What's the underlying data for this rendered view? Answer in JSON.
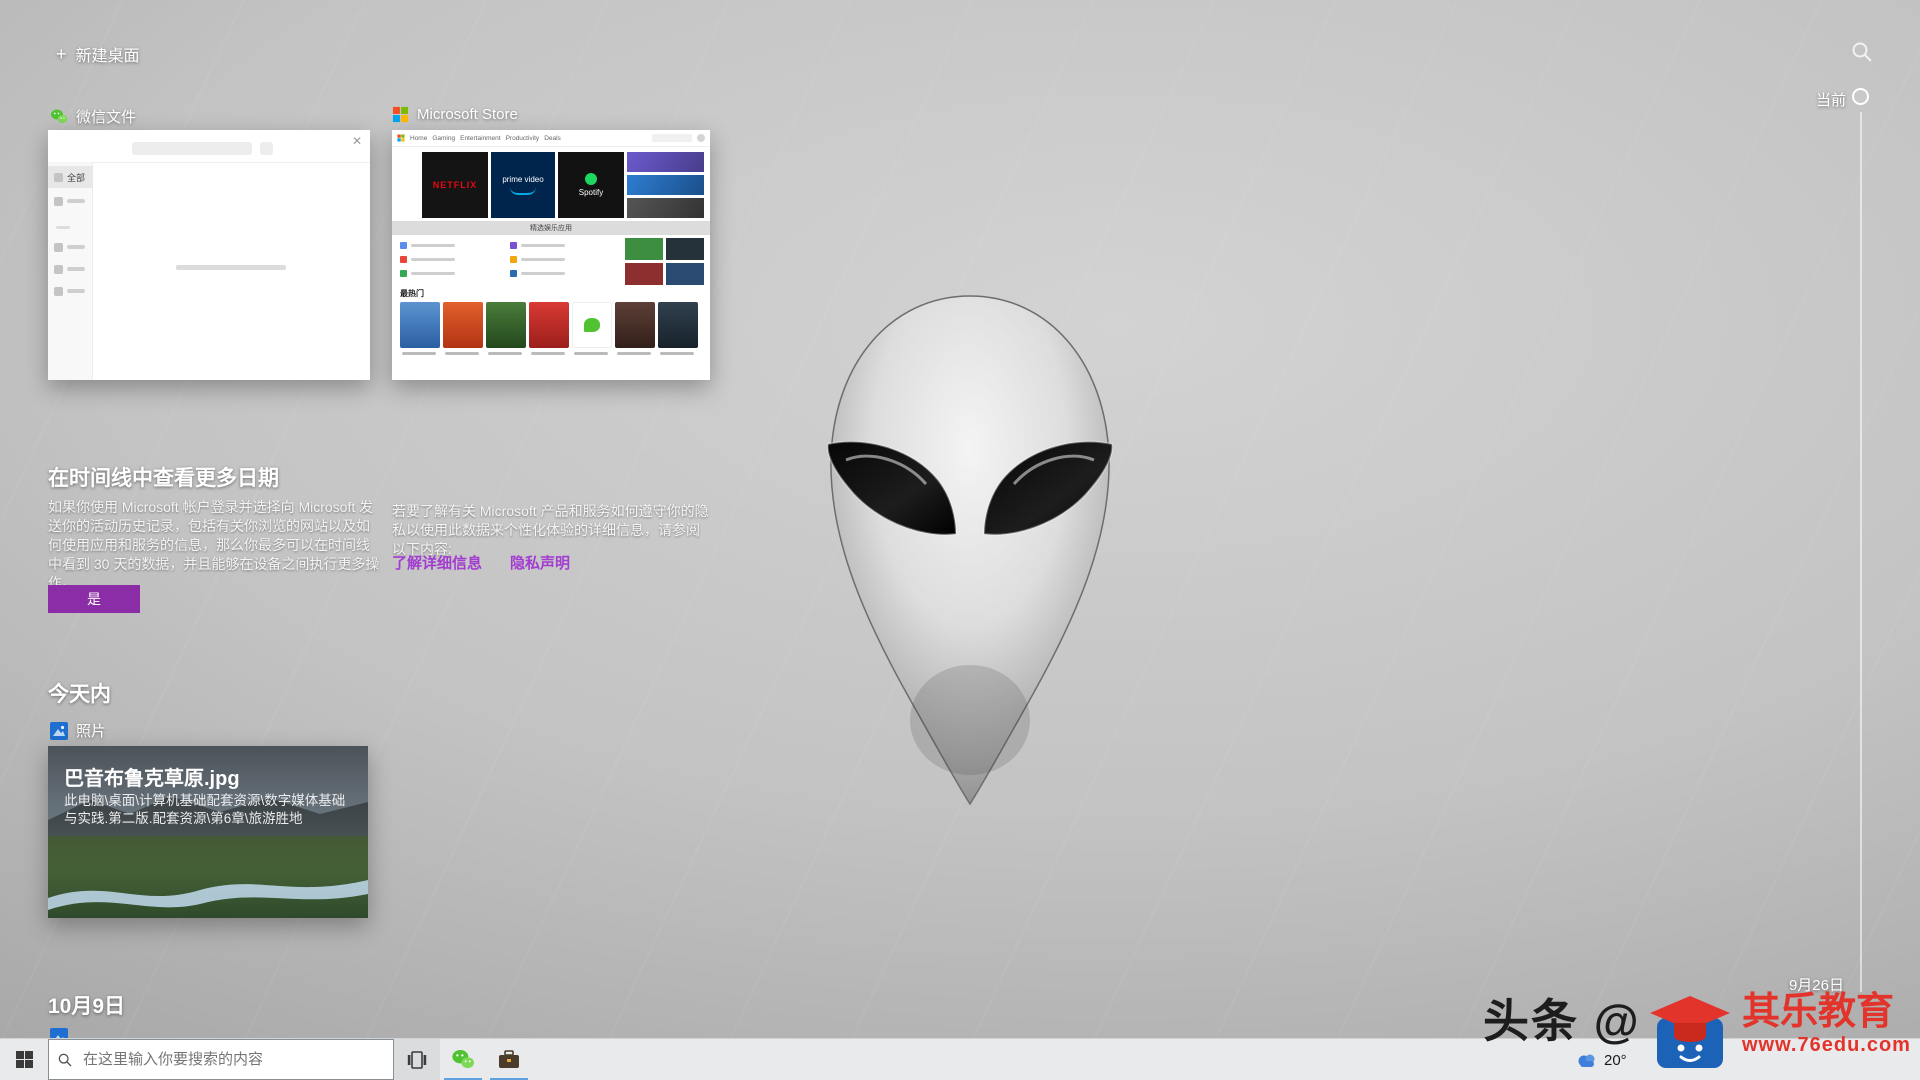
{
  "task_view": {
    "new_desktop": "新建桌面",
    "current": "当前",
    "bottom_date": "9月26日",
    "today_heading": "今天内",
    "oct9_heading": "10月9日"
  },
  "promo": {
    "title": "在时间线中查看更多日期",
    "body_left": "如果你使用 Microsoft 帐户登录并选择向 Microsoft 发送你的活动历史记录，包括有关你浏览的网站以及如何使用应用和服务的信息，那么你最多可以在时间线中看到 30 天的数据，并且能够在设备之间执行更多操作。",
    "body_right": "若要了解有关 Microsoft 产品和服务如何遵守你的隐私以使用此数据来个性化体验的详细信息，请参阅以下内容:",
    "learn_more": "了解详细信息",
    "privacy": "隐私声明",
    "yes": "是"
  },
  "apps": {
    "wechat": {
      "label": "微信文件",
      "sidebar_first": "全部"
    },
    "store": {
      "label": "Microsoft Store",
      "nav": [
        "Home",
        "Gaming",
        "Entertainment",
        "Productivity",
        "Deals"
      ],
      "hero": [
        "NETFLIX",
        "prime video",
        "Spotify"
      ],
      "banner": "精选娱乐应用",
      "hot": "最热门"
    },
    "photos": {
      "label": "照片"
    }
  },
  "today_card": {
    "title": "巴音布鲁克草原.jpg",
    "path": "此电脑\\桌面\\计算机基础配套资源\\数字媒体基础与实践.第二版.配套资源\\第6章\\旅游胜地"
  },
  "watermark": {
    "headline": "头条 @",
    "brand": "其乐教育",
    "url": "www.76edu.com"
  },
  "taskbar": {
    "search_placeholder": "在这里输入你要搜索的内容",
    "weather": "20°"
  },
  "colors": {
    "accent_purple": "#8b2da6",
    "link_purple": "#a33dd1",
    "wechat_green": "#51c332",
    "netflix_red": "#e50914",
    "spotify_green": "#1ed760",
    "brand_red": "#e3342b",
    "running_underline": "#5ea3e0"
  }
}
